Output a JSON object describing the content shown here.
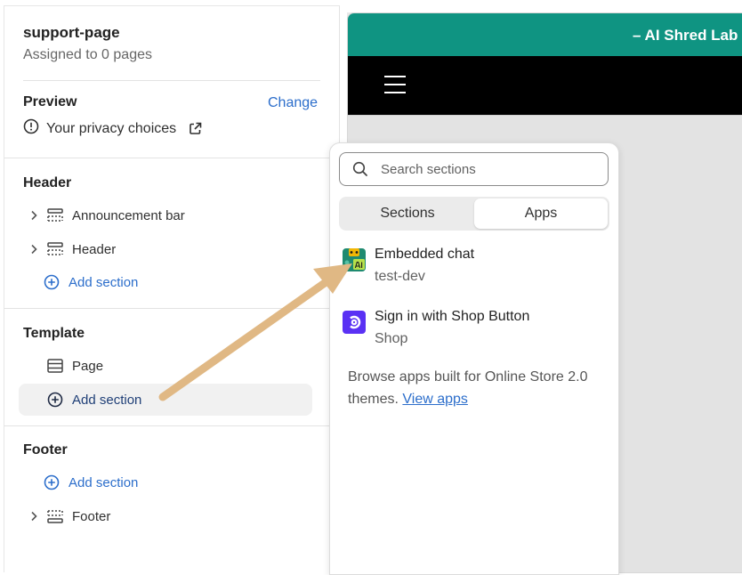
{
  "sidebar": {
    "page_title": "support-page",
    "page_subtitle": "Assigned to 0 pages",
    "preview_label": "Preview",
    "change_label": "Change",
    "privacy_label": "Your privacy choices",
    "groups": {
      "header": {
        "title": "Header",
        "items": [
          "Announcement bar",
          "Header"
        ],
        "add_label": "Add section"
      },
      "template": {
        "title": "Template",
        "items": [
          "Page"
        ],
        "add_label": "Add section"
      },
      "footer": {
        "title": "Footer",
        "add_label": "Add section",
        "items": [
          "Footer"
        ]
      }
    }
  },
  "preview": {
    "announcement_text": "– AI Shred Lab"
  },
  "popover": {
    "search_placeholder": "Search sections",
    "tabs": [
      "Sections",
      "Apps"
    ],
    "active_tab": "Apps",
    "apps": [
      {
        "name": "Embedded chat",
        "developer": "test-dev"
      },
      {
        "name": "Sign in with Shop Button",
        "developer": "Shop"
      }
    ],
    "browse_text": "Browse apps built for Online Store 2.0 themes.",
    "browse_link": "View apps"
  },
  "colors": {
    "accent_link": "#2c6ecb",
    "announcement_bg": "#0f9482",
    "arrow": "#e0b884",
    "shop_purple": "#5a31f4"
  },
  "icons": {
    "privacy": "info-circle-icon",
    "external": "external-link-icon",
    "chevron": "chevron-right-icon",
    "section": "section-icon",
    "add": "plus-circle-icon",
    "search": "search-icon",
    "menu": "hamburger-menu-icon"
  }
}
